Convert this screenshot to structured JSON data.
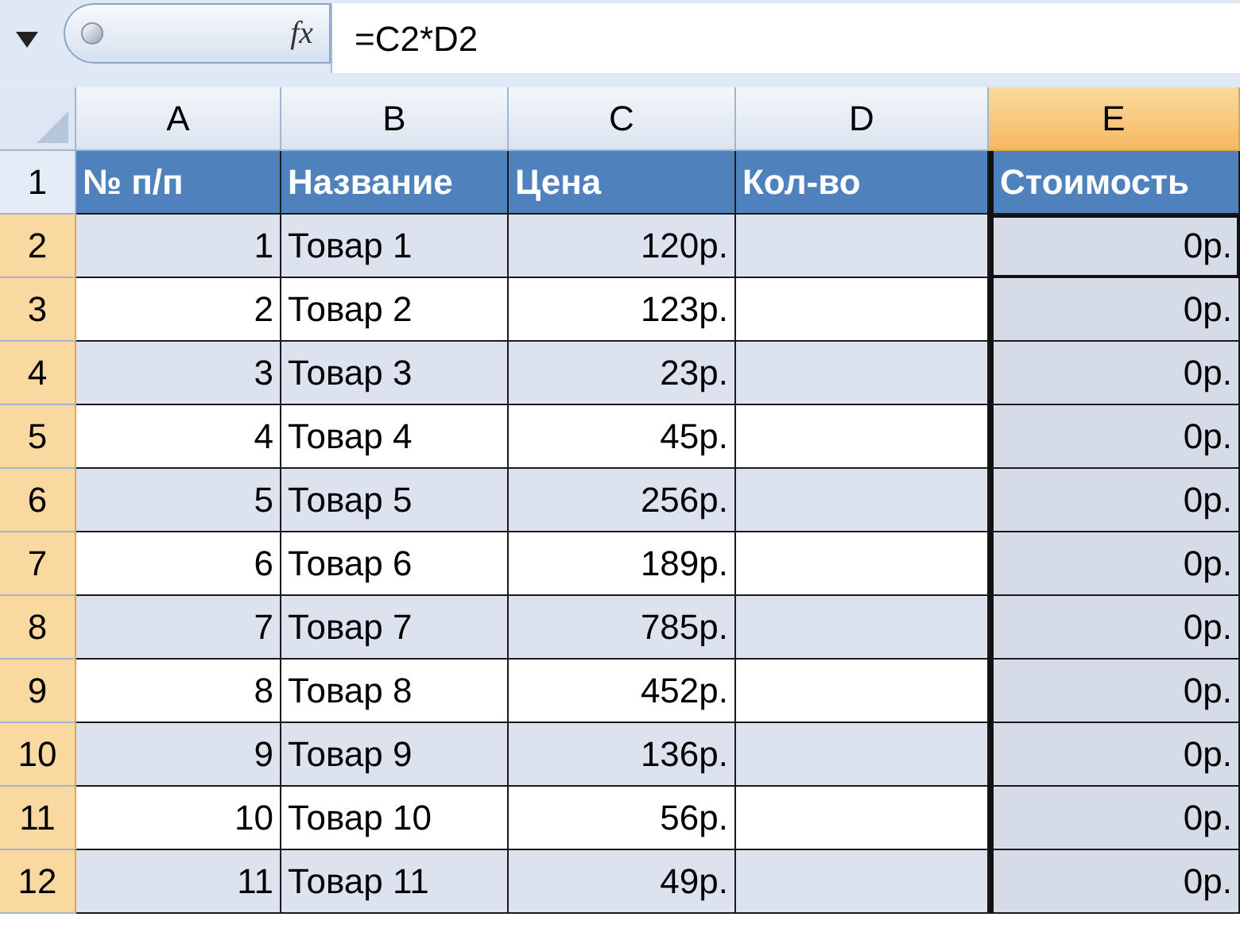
{
  "formula_bar": {
    "fx": "fx",
    "formula": "=C2*D2"
  },
  "columns": [
    {
      "letter": "A",
      "selected": false
    },
    {
      "letter": "B",
      "selected": false
    },
    {
      "letter": "C",
      "selected": false
    },
    {
      "letter": "D",
      "selected": false
    },
    {
      "letter": "E",
      "selected": true
    }
  ],
  "header_row": {
    "row_number": "1",
    "selected": false,
    "cells": [
      "№ п/п",
      "Название",
      "Цена",
      "Кол-во",
      "Стоимость"
    ]
  },
  "rows": [
    {
      "row_number": "2",
      "selected": true,
      "banded": true,
      "number": "1",
      "name": "Товар 1",
      "price": "120р.",
      "cost": "0р.",
      "active": true
    },
    {
      "row_number": "3",
      "selected": true,
      "banded": false,
      "number": "2",
      "name": "Товар 2",
      "price": "123р.",
      "cost": "0р.",
      "active": false
    },
    {
      "row_number": "4",
      "selected": true,
      "banded": true,
      "number": "3",
      "name": "Товар 3",
      "price": "23р.",
      "cost": "0р.",
      "active": false
    },
    {
      "row_number": "5",
      "selected": true,
      "banded": false,
      "number": "4",
      "name": "Товар 4",
      "price": "45р.",
      "cost": "0р.",
      "active": false
    },
    {
      "row_number": "6",
      "selected": true,
      "banded": true,
      "number": "5",
      "name": "Товар 5",
      "price": "256р.",
      "cost": "0р.",
      "active": false
    },
    {
      "row_number": "7",
      "selected": true,
      "banded": false,
      "number": "6",
      "name": "Товар 6",
      "price": "189р.",
      "cost": "0р.",
      "active": false
    },
    {
      "row_number": "8",
      "selected": true,
      "banded": true,
      "number": "7",
      "name": "Товар 7",
      "price": "785р.",
      "cost": "0р.",
      "active": false
    },
    {
      "row_number": "9",
      "selected": true,
      "banded": false,
      "number": "8",
      "name": "Товар 8",
      "price": "452р.",
      "cost": "0р.",
      "active": false
    },
    {
      "row_number": "10",
      "selected": true,
      "banded": true,
      "number": "9",
      "name": "Товар 9",
      "price": "136р.",
      "cost": "0р.",
      "active": false
    },
    {
      "row_number": "11",
      "selected": true,
      "banded": false,
      "number": "10",
      "name": "Товар 10",
      "price": "56р.",
      "cost": "0р.",
      "active": false
    },
    {
      "row_number": "12",
      "selected": true,
      "banded": true,
      "number": "11",
      "name": "Товар 11",
      "price": "49р.",
      "cost": "0р.",
      "active": false
    }
  ]
}
